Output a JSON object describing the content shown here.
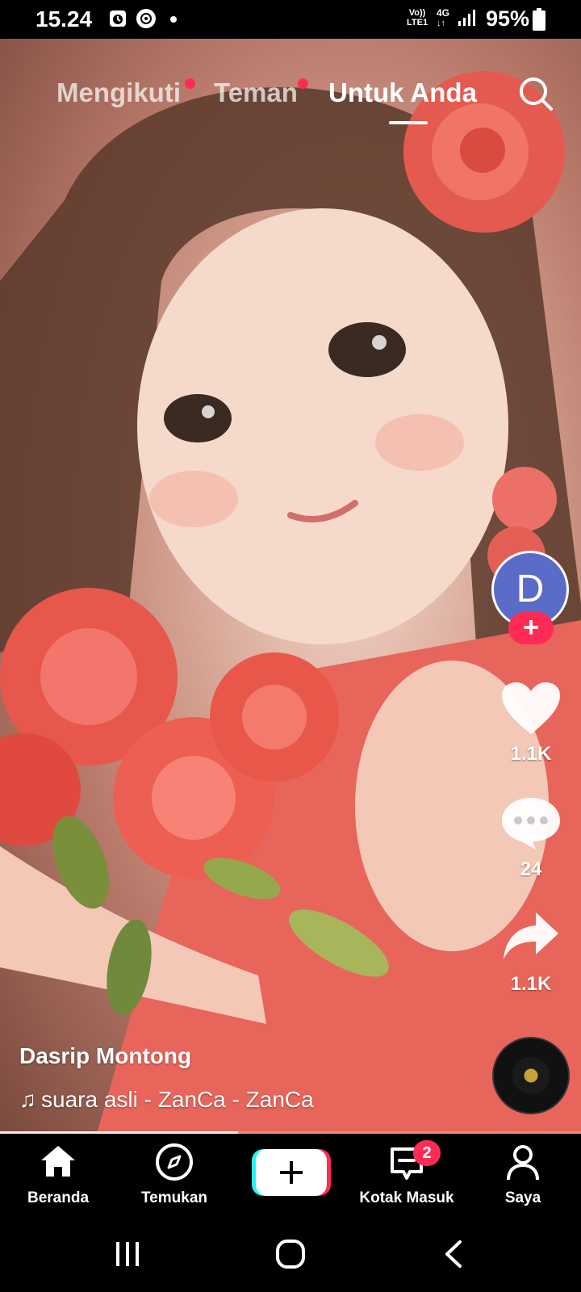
{
  "status_bar": {
    "time": "15.24",
    "network_label_top": "Vo))",
    "network_label_bottom": "LTE1",
    "network_type": "4G",
    "battery": "95%",
    "icons": [
      "alarm-icon",
      "cd-icon",
      "dot-icon",
      "signal-icon",
      "battery-icon"
    ]
  },
  "top_tabs": {
    "items": [
      {
        "label": "Mengikuti",
        "has_dot": true
      },
      {
        "label": "Teman",
        "has_dot": true
      },
      {
        "label": "Untuk Anda",
        "active": true
      }
    ],
    "search_icon": "search-icon"
  },
  "actions": {
    "avatar_letter": "D",
    "follow_icon": "plus-icon",
    "likes": "1.1K",
    "comments": "24",
    "shares": "1.1K"
  },
  "video": {
    "author": "Dasrip Montong",
    "music": "suara asli - ZanCa - ZanCa",
    "progress": 0.41
  },
  "bottom_nav": {
    "items": [
      {
        "label": "Beranda",
        "icon": "home-icon"
      },
      {
        "label": "Temukan",
        "icon": "compass-icon"
      },
      {
        "label": "",
        "icon": "create-plus-icon"
      },
      {
        "label": "Kotak Masuk",
        "icon": "inbox-icon"
      },
      {
        "label": "Saya",
        "icon": "profile-icon"
      }
    ],
    "inbox_badge": "2"
  },
  "colors": {
    "accent": "#fe2c55",
    "avatar_bg": "#5b6bc8",
    "nav_bg": "#000000",
    "create_cyan": "#25f4ee"
  }
}
